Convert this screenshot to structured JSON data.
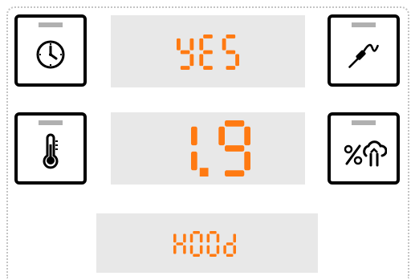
{
  "keys": {
    "timer": {
      "icon": "clock-icon"
    },
    "probe": {
      "icon": "core-probe-icon"
    },
    "temperature": {
      "icon": "thermometer-icon"
    },
    "humidity": {
      "icon": "humidity-icon"
    }
  },
  "displays": {
    "top": {
      "text": "YES"
    },
    "middle": {
      "text": "1.9."
    },
    "bottom": {
      "text": "HOOD"
    }
  },
  "colors": {
    "segment": "#ff7a12",
    "display_bg": "#e8e8e8",
    "key_border": "#000000",
    "led_off": "#b0b0b0"
  }
}
